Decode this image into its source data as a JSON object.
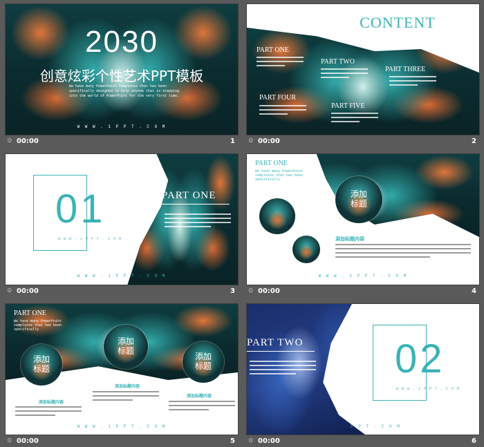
{
  "colors": {
    "teal": "#3ab3b6",
    "orange": "#e0753a",
    "panel": "#5a5a5a",
    "blue": "#2b4fa0"
  },
  "slides": [
    {
      "number": "1",
      "time": "00:00",
      "year": "2030",
      "title": "创意炫彩个性艺术PPT模板",
      "subtitle": "We have many PowerPoint templates that has been specifically designed to help anyone that is stepping into the world of PowerPoint for the very first time.",
      "url": "W W W . 1 P P T . C O M"
    },
    {
      "number": "2",
      "time": "00:00",
      "heading": "CONTENT",
      "parts": [
        "PART ONE",
        "PART TWO",
        "PART THREE",
        "PART FOUR",
        "PART FIVE"
      ]
    },
    {
      "number": "3",
      "time": "00:00",
      "big_number": "01",
      "part": "PART ONE",
      "url_small": "W W W . 1 P P T . C O M",
      "url": "W W W . 1 P P T . C O M"
    },
    {
      "number": "4",
      "time": "00:00",
      "part": "PART ONE",
      "caption": "We have many PowerPoint templates that has been specifically",
      "circle_label": "添加标题",
      "heading": "添加标题内容",
      "url": "W W W . 1 P P T . C O M"
    },
    {
      "number": "5",
      "time": "00:00",
      "part": "PART ONE",
      "caption": "We have many PowerPoint templates that has been specifically",
      "circle_labels": [
        "添加标题",
        "添加标题",
        "添加标题"
      ],
      "headings": [
        "添加标题内容",
        "添加标题内容",
        "添加标题内容"
      ],
      "url": "W W W . 1 P P T . C O M"
    },
    {
      "number": "6",
      "time": "00:00",
      "part": "PART TWO",
      "big_number": "02",
      "url_small": "W W W . 1 P P T . C O M",
      "url": "P P T . C O M"
    }
  ],
  "star_icon": "star-icon"
}
